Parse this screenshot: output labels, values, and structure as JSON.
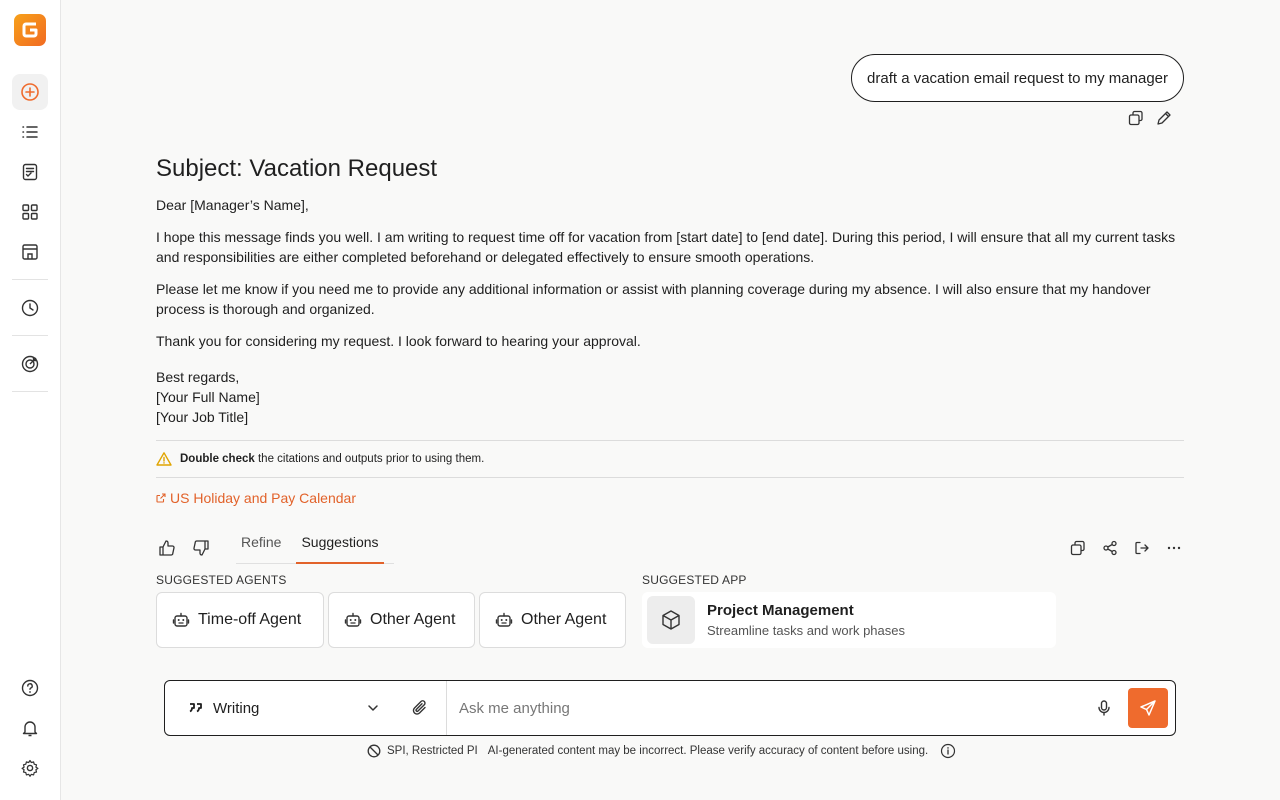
{
  "app": {
    "brand_color": "#ef6b2d"
  },
  "sidebar": {
    "items": [
      {
        "name": "new-chat",
        "icon": "plus-circle-icon"
      },
      {
        "name": "list",
        "icon": "list-icon"
      },
      {
        "name": "tasks",
        "icon": "checklist-doc-icon"
      },
      {
        "name": "apps",
        "icon": "grid-icon"
      },
      {
        "name": "store",
        "icon": "store-icon"
      },
      {
        "name": "history",
        "icon": "history-icon"
      },
      {
        "name": "goals",
        "icon": "target-icon"
      }
    ],
    "bottom": [
      {
        "name": "help",
        "icon": "help-icon"
      },
      {
        "name": "notifications",
        "icon": "bell-icon"
      },
      {
        "name": "settings",
        "icon": "gear-icon"
      }
    ]
  },
  "conversation": {
    "user_message": "draft a vacation email request to my manager",
    "response": {
      "subject": "Subject: Vacation Request",
      "greeting": "Dear [Manager’s Name],",
      "p1": "I hope this message finds you well. I am writing to request time off for vacation from [start date] to [end date]. During this period, I will ensure that all my current tasks and responsibilities are either completed beforehand or delegated effectively to ensure smooth operations.",
      "p2": "Please let me know if you need me to provide any additional information or assist with planning coverage during my absence. I will also ensure that my handover process is thorough and organized.",
      "p3": "Thank you for considering my request. I look forward to hearing your approval.",
      "closing": "Best regards,",
      "name": "[Your Full Name]",
      "title": "[Your Job Title]"
    },
    "warning_bold": "Double check",
    "warning_text": " the citations and outputs prior to using them.",
    "citation_link": "US Holiday and Pay Calendar"
  },
  "tabs": [
    {
      "label": "Refine",
      "active": false
    },
    {
      "label": "Suggestions",
      "active": true
    }
  ],
  "suggestions": {
    "agents_label": "SUGGESTED AGENTS",
    "agents": [
      "Time-off Agent",
      "Other Agent",
      "Other Agent"
    ],
    "app_label": "SUGGESTED APP",
    "app": {
      "title": "Project Management",
      "subtitle": "Streamline tasks and work phases"
    }
  },
  "composer": {
    "mode": "Writing",
    "placeholder": "Ask me anything"
  },
  "footer": {
    "classification": "SPI, Restricted PI",
    "disclaimer": "AI-generated content may be incorrect. Please verify accuracy of content before using."
  }
}
